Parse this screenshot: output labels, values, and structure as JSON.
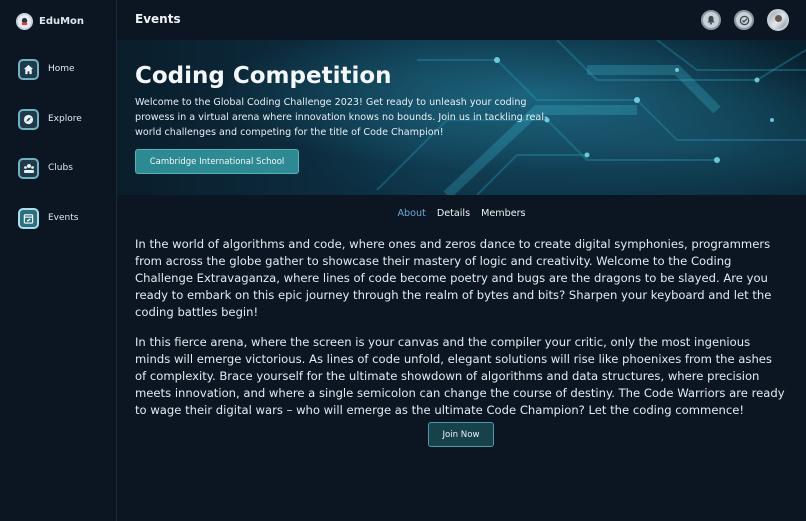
{
  "brand": {
    "name": "EduMon"
  },
  "sidebar": {
    "items": [
      {
        "label": "Home",
        "icon": "home-icon"
      },
      {
        "label": "Explore",
        "icon": "compass-icon"
      },
      {
        "label": "Clubs",
        "icon": "group-icon"
      },
      {
        "label": "Events",
        "icon": "calendar-edit-icon",
        "active": true
      }
    ]
  },
  "header": {
    "title": "Events",
    "icons": [
      "bell-icon",
      "check-badge-icon",
      "avatar"
    ]
  },
  "hero": {
    "title": "Coding Competition",
    "description": "Welcome to the Global Coding Challenge 2023! Get ready to unleash your coding prowess in a virtual arena where innovation knows no bounds. Join us in tackling real-world challenges and competing for the title of Code Champion!",
    "organizer": "Cambridge International School"
  },
  "tabs": [
    {
      "label": "About",
      "active": true
    },
    {
      "label": "Details"
    },
    {
      "label": "Members"
    }
  ],
  "about": {
    "paragraph1": "In the world of algorithms and code, where ones and zeros dance to create digital symphonies, programmers from across the globe gather to showcase their mastery of logic and creativity. Welcome to the Coding Challenge Extravaganza, where lines of code become poetry and bugs are the dragons to be slayed. Are you ready to embark on this epic journey through the realm of bytes and bits? Sharpen your keyboard and let the coding battles begin!",
    "paragraph2": "In this fierce arena, where the screen is your canvas and the compiler your critic, only the most ingenious minds will emerge victorious. As lines of code unfold, elegant solutions will rise like phoenixes from the ashes of complexity. Brace yourself for the ultimate showdown of algorithms and data structures, where precision meets innovation, and where a single semicolon can change the course of destiny. The Code Warriors are ready to wage their digital wars – who will emerge as the ultimate Code Champion? Let the coding commence!"
  },
  "actions": {
    "join_label": "Join Now"
  },
  "colors": {
    "background": "#0b1622",
    "accent": "#2e8a92",
    "active_tab": "#6ea8d8"
  }
}
